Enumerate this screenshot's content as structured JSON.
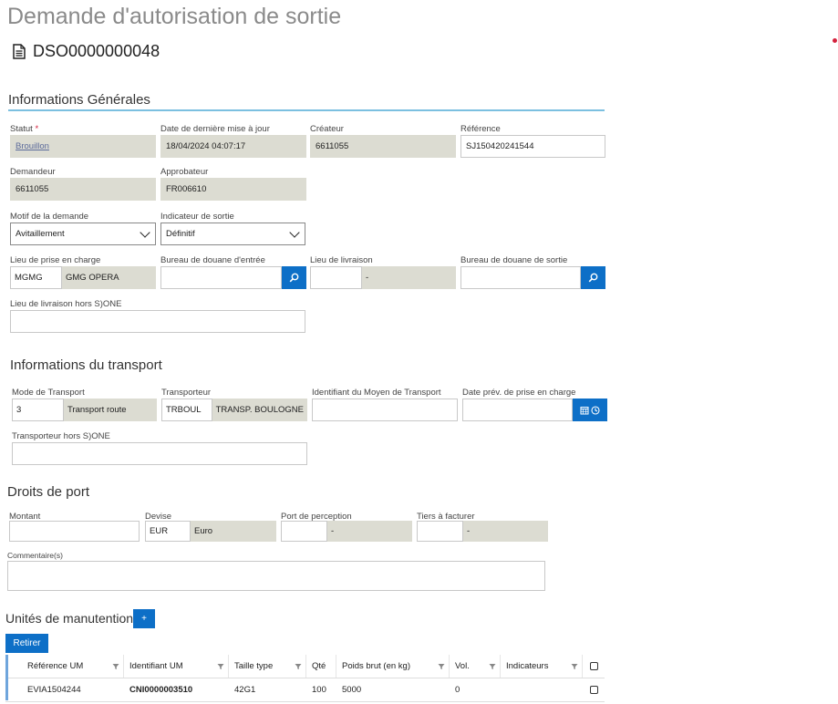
{
  "page": {
    "title": "Demande d'autorisation de sortie",
    "doc_id": "DSO0000000048"
  },
  "general": {
    "section_title": "Informations Générales",
    "statut_label": "Statut",
    "statut_required": "*",
    "statut_value": "Brouillon",
    "date_maj_label": "Date de dernière mise à jour",
    "date_maj_value": "18/04/2024 04:07:17",
    "createur_label": "Créateur",
    "createur_value": "6611055",
    "reference_label": "Référence",
    "reference_value": "SJ150420241544",
    "demandeur_label": "Demandeur",
    "demandeur_value": "6611055",
    "approbateur_label": "Approbateur",
    "approbateur_value": "FR006610",
    "motif_label": "Motif de la demande",
    "motif_value": "Avitaillement",
    "indicateur_label": "Indicateur de sortie",
    "indicateur_value": "Définitif",
    "prise_label": "Lieu de prise en charge",
    "prise_code": "MGMG",
    "prise_name": "GMG OPERA",
    "douane_entree_label": "Bureau de douane d'entrée",
    "douane_entree_value": "",
    "livraison_label": "Lieu de livraison",
    "livraison_code": "",
    "livraison_name": "-",
    "douane_sortie_label": "Bureau de douane de sortie",
    "douane_sortie_value": "",
    "hors_sjone_label": "Lieu de livraison hors S)ONE",
    "hors_sjone_value": ""
  },
  "transport": {
    "section_title": "Informations du transport",
    "mode_label": "Mode de Transport",
    "mode_code": "3",
    "mode_name": "Transport route",
    "transporteur_label": "Transporteur",
    "transporteur_code": "TRBOUL",
    "transporteur_name": "TRANSP. BOULOGNE",
    "identifiant_label": "Identifiant du Moyen de Transport",
    "identifiant_value": "",
    "date_prev_label": "Date prév. de prise en charge",
    "date_prev_value": "",
    "hors_sjone_label": "Transporteur hors S)ONE",
    "hors_sjone_value": ""
  },
  "droits": {
    "section_title": "Droits de port",
    "montant_label": "Montant",
    "montant_value": "",
    "devise_label": "Devise",
    "devise_code": "EUR",
    "devise_name": "Euro",
    "port_label": "Port de perception",
    "port_code": "",
    "port_name": "-",
    "tiers_label": "Tiers à facturer",
    "tiers_code": "",
    "tiers_name": "-",
    "commentaire_label": "Commentaire(s)",
    "commentaire_value": ""
  },
  "unites": {
    "section_title": "Unités de manutention",
    "add_label": "+",
    "retirer_label": "Retirer",
    "columns": [
      "Référence UM",
      "Identifiant UM",
      "Taille type",
      "Qté",
      "Poids brut (en kg)",
      "Vol.",
      "Indicateurs"
    ],
    "rows": [
      {
        "reference": "EVIA1504244",
        "identifiant": "CNI0000003510",
        "taille": "42G1",
        "qte": "100",
        "poids": "5000",
        "vol": "0",
        "indicateurs": ""
      }
    ]
  },
  "colors": {
    "accent": "#0d6fc7",
    "readonly": "#dcdcd2",
    "section_line": "#7cc0e0",
    "required": "#d4213d"
  }
}
